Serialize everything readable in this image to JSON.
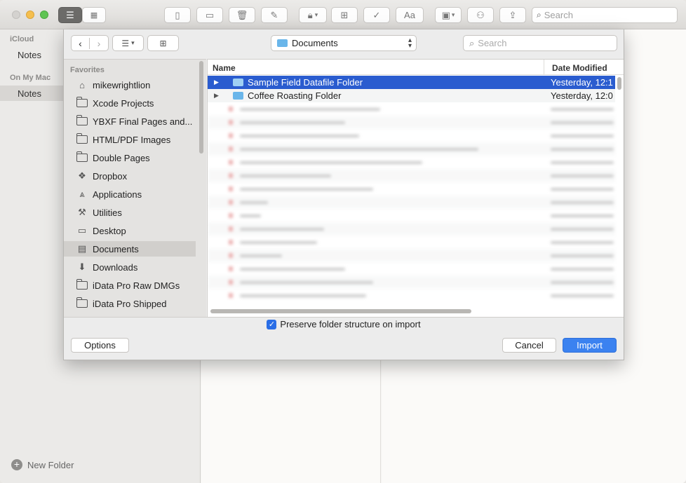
{
  "notes_window": {
    "search_placeholder": "Search",
    "sidebar": {
      "sections": [
        {
          "header": "iCloud",
          "items": [
            {
              "label": "Notes",
              "selected": false
            }
          ]
        },
        {
          "header": "On My Mac",
          "items": [
            {
              "label": "Notes",
              "selected": true
            }
          ]
        }
      ],
      "new_folder_label": "New Folder"
    },
    "toolbar_icons": [
      "list-view-icon",
      "gallery-view-icon",
      "sidebar-icon",
      "attachments-icon",
      "trash-icon",
      "compose-icon",
      "lock-icon",
      "table-icon",
      "checklist-icon",
      "format-icon",
      "media-icon",
      "collaborate-icon",
      "share-icon"
    ],
    "format_label": "Aa"
  },
  "dialog": {
    "location": "Documents",
    "search_placeholder": "Search",
    "sidebar": {
      "header": "Favorites",
      "items": [
        {
          "label": "mikewrightlion",
          "icon": "home-icon",
          "selected": false
        },
        {
          "label": "Xcode Projects",
          "icon": "folder-icon",
          "selected": false
        },
        {
          "label": "YBXF Final Pages and...",
          "icon": "folder-icon",
          "selected": false
        },
        {
          "label": "HTML/PDF Images",
          "icon": "folder-icon",
          "selected": false
        },
        {
          "label": "Double Pages",
          "icon": "folder-icon",
          "selected": false
        },
        {
          "label": "Dropbox",
          "icon": "dropbox-icon",
          "selected": false
        },
        {
          "label": "Applications",
          "icon": "applications-icon",
          "selected": false
        },
        {
          "label": "Utilities",
          "icon": "utilities-icon",
          "selected": false
        },
        {
          "label": "Desktop",
          "icon": "desktop-icon",
          "selected": false
        },
        {
          "label": "Documents",
          "icon": "documents-icon",
          "selected": true
        },
        {
          "label": "Downloads",
          "icon": "downloads-icon",
          "selected": false
        },
        {
          "label": "iData Pro Raw DMGs",
          "icon": "folder-icon",
          "selected": false
        },
        {
          "label": "iData Pro Shipped",
          "icon": "folder-icon",
          "selected": false
        }
      ]
    },
    "columns": {
      "name": "Name",
      "date": "Date Modified"
    },
    "files": [
      {
        "name": "Sample Field Datafile Folder",
        "date": "Yesterday, 12:1",
        "selected": true
      },
      {
        "name": "Coffee Roasting Folder",
        "date": "Yesterday, 12:0",
        "selected": false
      }
    ],
    "preserve_label": "Preserve folder structure on import",
    "preserve_checked": true,
    "buttons": {
      "options": "Options",
      "cancel": "Cancel",
      "import": "Import"
    }
  }
}
